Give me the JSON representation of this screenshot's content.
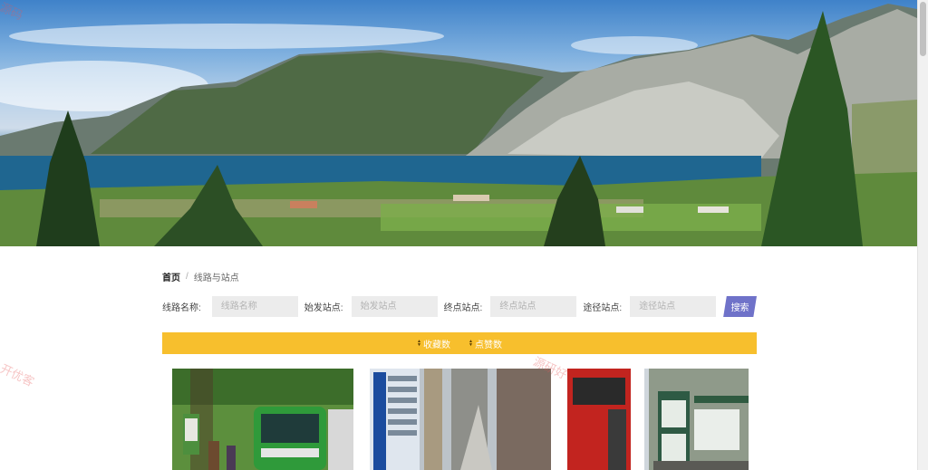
{
  "breadcrumb": {
    "home": "首页",
    "separator": "/",
    "current": "线路与站点"
  },
  "search": {
    "route_name": {
      "label": "线路名称:",
      "placeholder": "线路名称"
    },
    "start_station": {
      "label": "始发站点:",
      "placeholder": "始发站点"
    },
    "end_station": {
      "label": "终点站点:",
      "placeholder": "终点站点"
    },
    "via_station": {
      "label": "途径站点:",
      "placeholder": "途径站点"
    },
    "button_label": "搜索"
  },
  "sort_bar": {
    "items": [
      {
        "label": "收藏数",
        "icon": "sort-arrows-icon"
      },
      {
        "label": "点赞数",
        "icon": "sort-arrows-icon"
      }
    ]
  },
  "cards": [
    {
      "image": "green-bus-photo"
    },
    {
      "image": "bus-stop-signboard-photo"
    },
    {
      "image": "red-bus-photo"
    },
    {
      "image": "bus-shelter-photo"
    }
  ],
  "watermarks": [
    "源码",
    "源研好",
    "开优客"
  ],
  "colors": {
    "accent": "#6f72c9",
    "sort_bar": "#f7bf2d"
  }
}
